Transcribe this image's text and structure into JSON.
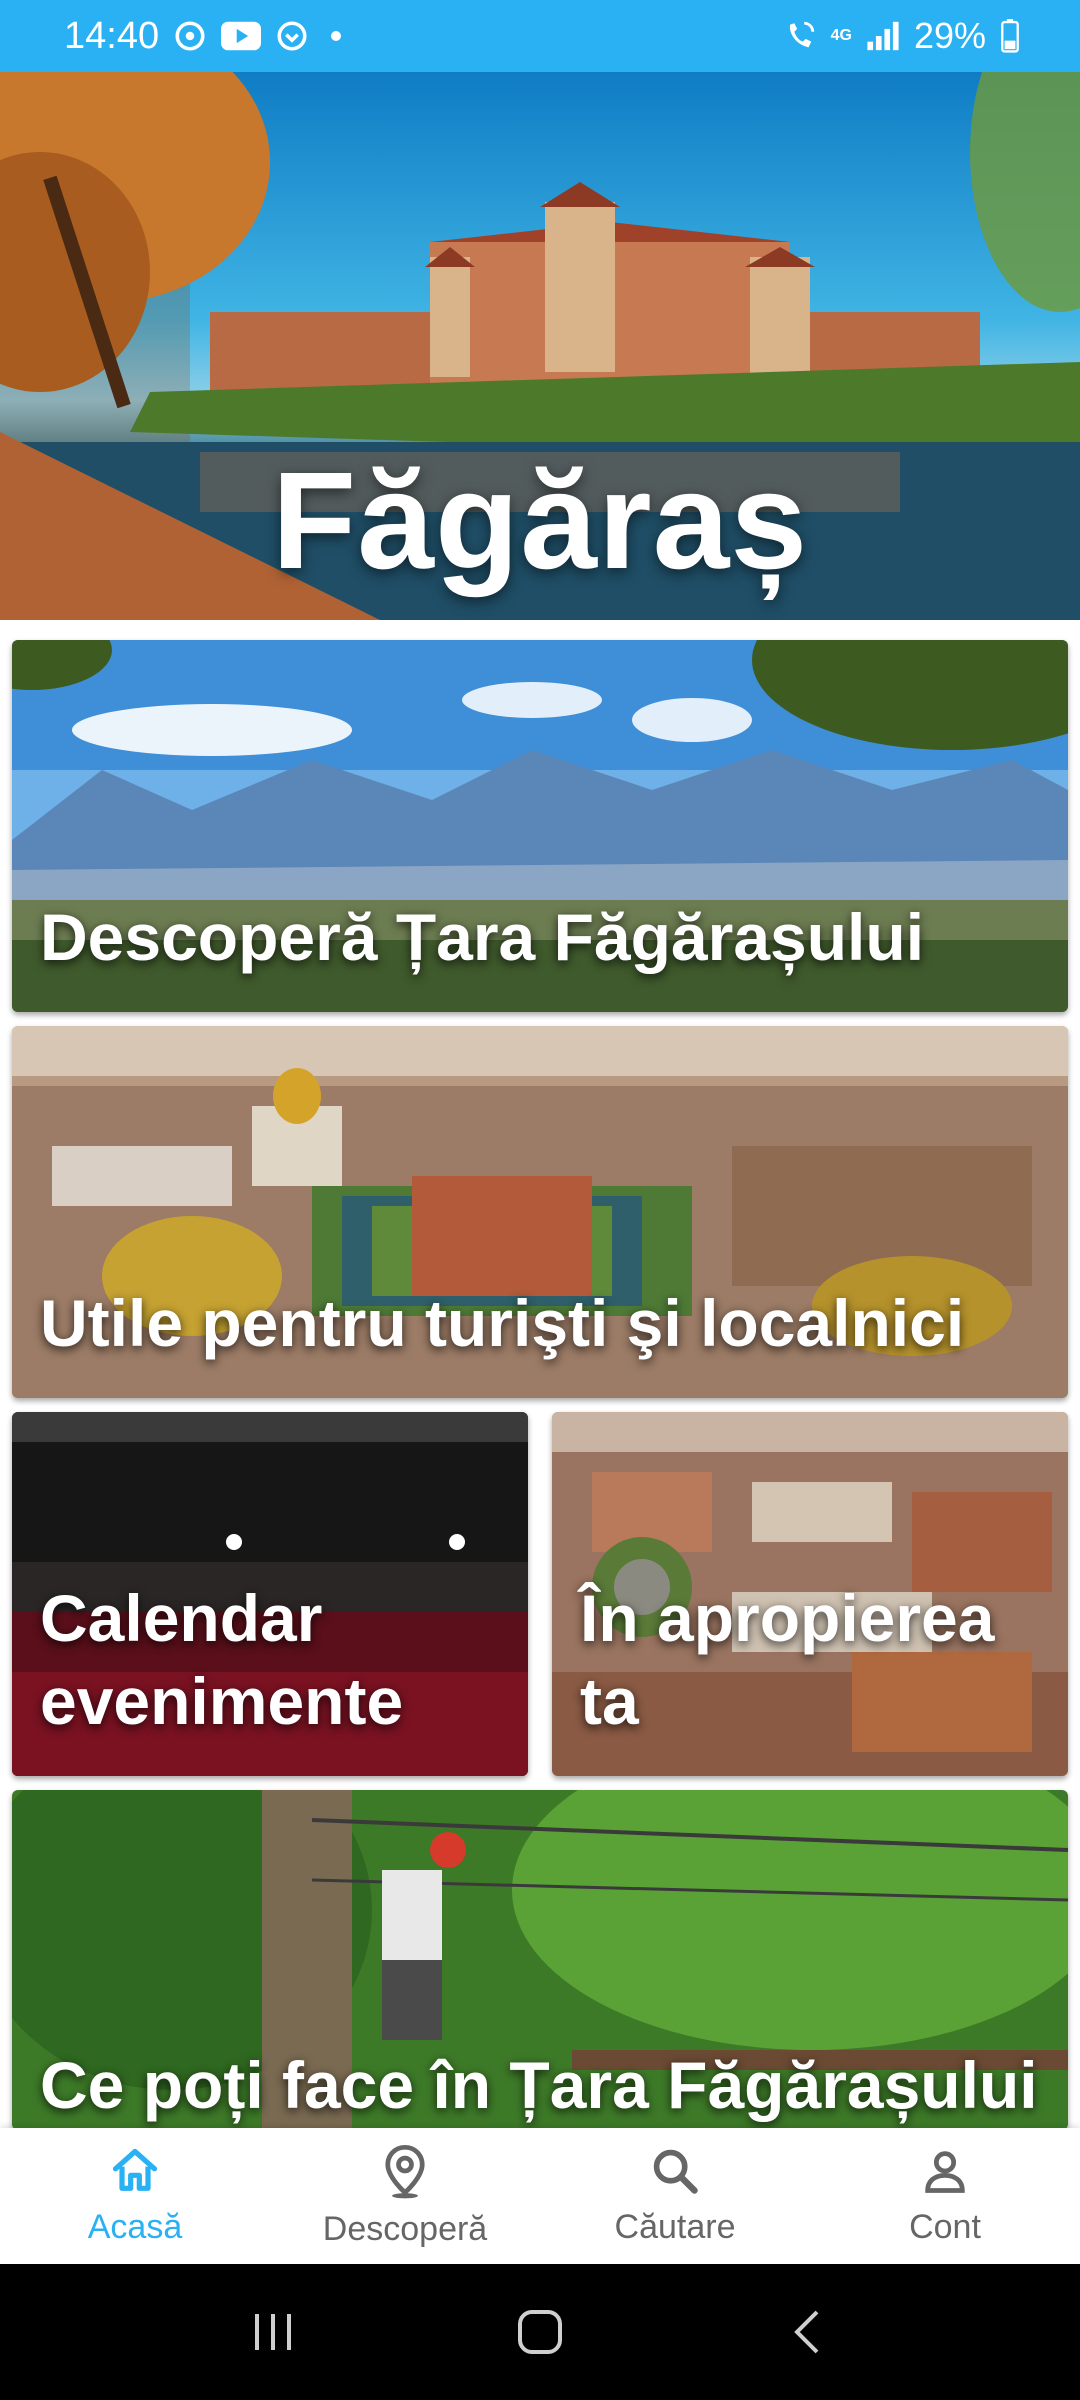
{
  "status_bar": {
    "time": "14:40",
    "network": "4G",
    "battery": "29%",
    "icons": [
      "sync-icon",
      "youtube-icon",
      "music-icon",
      "dot-icon",
      "wifi-call-icon",
      "signal-icon",
      "battery-icon"
    ]
  },
  "hero": {
    "title": "Făgăraș"
  },
  "cards": [
    {
      "label": "Descoperă Țara Făgărașului"
    },
    {
      "label": "Utile pentru turişti şi localnici"
    },
    {
      "label": "Calendar evenimente"
    },
    {
      "label": "În apropierea ta"
    },
    {
      "label": "Ce poți face în Țara Făgărașului"
    }
  ],
  "bottom_nav": {
    "items": [
      {
        "label": "Acasă",
        "icon": "home-icon",
        "active": true
      },
      {
        "label": "Descoperă",
        "icon": "location-pin-icon",
        "active": false
      },
      {
        "label": "Căutare",
        "icon": "search-icon",
        "active": false
      },
      {
        "label": "Cont",
        "icon": "person-icon",
        "active": false
      }
    ]
  },
  "colors": {
    "accent": "#29b1f4",
    "nav_inactive": "#666666"
  }
}
